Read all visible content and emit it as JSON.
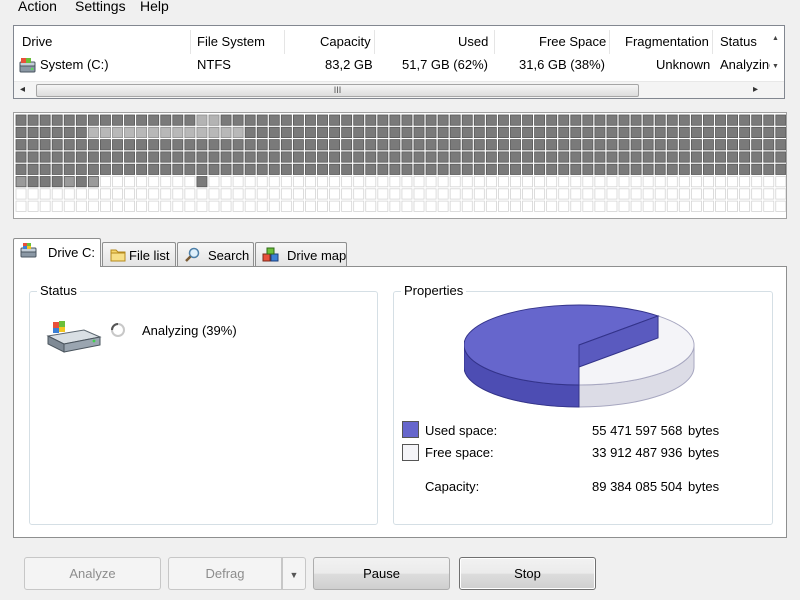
{
  "menu": {
    "items": [
      {
        "label": "Action"
      },
      {
        "label": "Settings"
      },
      {
        "label": "Help"
      }
    ]
  },
  "drive_list": {
    "columns": [
      "Drive",
      "File System",
      "Capacity",
      "Used",
      "Free Space",
      "Fragmentation",
      "Status"
    ],
    "rows": [
      {
        "drive": "System (C:)",
        "file_system": "NTFS",
        "capacity": "83,2 GB",
        "used": "51,7 GB (62%)",
        "free_space": "31,6 GB (38%)",
        "fragmentation": "Unknown",
        "status": "Analyzing"
      }
    ],
    "scroll_grip": "III"
  },
  "cluster_map": {
    "state": "partially analyzed",
    "filled_fraction": 0.39
  },
  "tabs": [
    {
      "label": "Drive C:",
      "icon": "drive-icon",
      "active": true
    },
    {
      "label": "File list",
      "icon": "folder-icon",
      "active": false
    },
    {
      "label": "Search",
      "icon": "magnifier-icon",
      "active": false
    },
    {
      "label": "Drive map",
      "icon": "blocks-icon",
      "active": false
    }
  ],
  "status": {
    "title": "Status",
    "text": "Analyzing (39%)"
  },
  "properties": {
    "title": "Properties",
    "used_label": "Used space:",
    "used_value": "55 471 597 568",
    "free_label": "Free space:",
    "free_value": "33 912 487 936",
    "capacity_label": "Capacity:",
    "capacity_value": "89 384 085 504",
    "unit": "bytes",
    "used_color": "#6666cc",
    "free_color": "#f4f4f8"
  },
  "chart_data": {
    "type": "pie",
    "categories": [
      "Used space",
      "Free space"
    ],
    "values": [
      55471597568,
      33912487936
    ],
    "colors": [
      "#6666cc",
      "#f4f4f8"
    ]
  },
  "buttons": {
    "analyze": "Analyze",
    "defrag": "Defrag",
    "pause": "Pause",
    "stop": "Stop"
  }
}
